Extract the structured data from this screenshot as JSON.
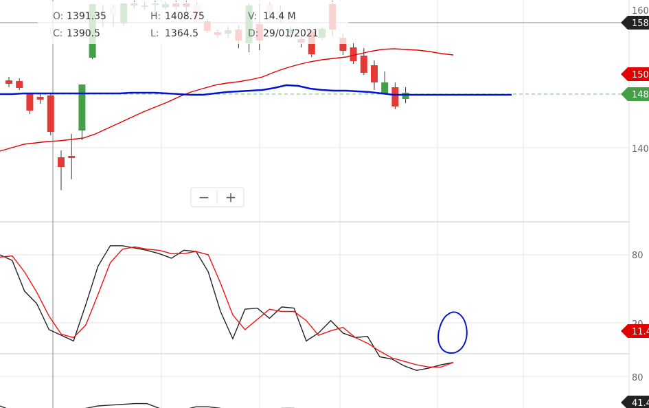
{
  "ohlc_info": {
    "open_label": "O:",
    "open_value": "1391.35",
    "high_label": "H:",
    "high_value": "1408.75",
    "volume_label": "V:",
    "volume_value": "14.4 M",
    "close_label": "C:",
    "close_value": "1390.5",
    "low_label": "L:",
    "low_value": "1364.5",
    "date_label": "D:",
    "date_value": "29/01/2021"
  },
  "zoom": {
    "minus": "−",
    "plus": "+"
  },
  "price_axis": {
    "tick_top": "160",
    "tick_mid": "140",
    "badge_top": "158",
    "badge_ma_red": "150",
    "badge_ma_blue": "148"
  },
  "osc_axis": {
    "tick_80": "80",
    "tick_20": "20",
    "badge": "11.4"
  },
  "ind3_axis": {
    "tick_80": "80",
    "badge": "41.4"
  },
  "colors": {
    "up": "#43a047",
    "up_light": "#c8e6c9",
    "down": "#e53935",
    "down_light": "#ffcdd2",
    "ma_red": "#e00000",
    "ma_blue": "#0014d0",
    "osc_k": "#222222",
    "osc_d": "#ee1111",
    "annotation": "#0016c8",
    "grid": "#e6e6e6",
    "axis_badge": "#222222"
  },
  "chart_data": [
    {
      "type": "candlestick",
      "title": "",
      "y_ticks": [
        1400,
        1600
      ],
      "ylim": [
        1360,
        1610
      ],
      "candles": [
        {
          "o": 1498,
          "h": 1503,
          "l": 1488,
          "c": 1493,
          "fill": "down"
        },
        {
          "o": 1497,
          "h": 1501,
          "l": 1484,
          "c": 1487,
          "fill": "down"
        },
        {
          "o": 1478,
          "h": 1480,
          "l": 1449,
          "c": 1454,
          "fill": "down"
        },
        {
          "o": 1474,
          "h": 1478,
          "l": 1464,
          "c": 1470,
          "fill": "down"
        },
        {
          "o": 1476,
          "h": 1478,
          "l": 1418,
          "c": 1423,
          "fill": "down"
        },
        {
          "o": 1386,
          "h": 1396,
          "l": 1338,
          "c": 1372,
          "fill": "down"
        },
        {
          "o": 1388,
          "h": 1420,
          "l": 1354,
          "c": 1385,
          "fill": "down"
        },
        {
          "o": 1425,
          "h": 1492,
          "l": 1411,
          "c": 1492,
          "fill": "up"
        },
        {
          "o": 1531,
          "h": 1609,
          "l": 1529,
          "c": 1609,
          "fill": "up"
        },
        {
          "o": 1600,
          "h": 1608,
          "l": 1576,
          "c": 1592,
          "fill": "up_light"
        },
        {
          "o": 1593,
          "h": 1608,
          "l": 1576,
          "c": 1605,
          "fill": "up_light"
        },
        {
          "o": 1581,
          "h": 1610,
          "l": 1578,
          "c": 1610,
          "fill": "up"
        },
        {
          "o": 1610,
          "h": 1614,
          "l": 1603,
          "c": 1607,
          "fill": "down"
        },
        {
          "o": 1607,
          "h": 1613,
          "l": 1601,
          "c": 1605,
          "fill": "up"
        },
        {
          "o": 1608,
          "h": 1614,
          "l": 1592,
          "c": 1610,
          "fill": "up"
        },
        {
          "o": 1604,
          "h": 1613,
          "l": 1601,
          "c": 1609,
          "fill": "up"
        },
        {
          "o": 1610,
          "h": 1614,
          "l": 1600,
          "c": 1605,
          "fill": "down"
        },
        {
          "o": 1610,
          "h": 1614,
          "l": 1598,
          "c": 1605,
          "fill": "down"
        },
        {
          "o": 1608,
          "h": 1612,
          "l": 1582,
          "c": 1584,
          "fill": "down_light"
        },
        {
          "o": 1584,
          "h": 1588,
          "l": 1567,
          "c": 1570,
          "fill": "down"
        },
        {
          "o": 1568,
          "h": 1572,
          "l": 1560,
          "c": 1564,
          "fill": "down"
        },
        {
          "o": 1566,
          "h": 1576,
          "l": 1560,
          "c": 1571,
          "fill": "up"
        },
        {
          "o": 1572,
          "h": 1578,
          "l": 1545,
          "c": 1556,
          "fill": "down"
        },
        {
          "o": 1552,
          "h": 1610,
          "l": 1539,
          "c": 1607,
          "fill": "up"
        },
        {
          "o": 1580,
          "h": 1610,
          "l": 1542,
          "c": 1556,
          "fill": "down"
        },
        {
          "o": 1608,
          "h": 1612,
          "l": 1586,
          "c": 1599,
          "fill": "down_light"
        },
        {
          "o": 1600,
          "h": 1607,
          "l": 1582,
          "c": 1592,
          "fill": "up_light"
        },
        {
          "o": 1573,
          "h": 1576,
          "l": 1563,
          "c": 1567,
          "fill": "up"
        },
        {
          "o": 1558,
          "h": 1565,
          "l": 1546,
          "c": 1553,
          "fill": "down"
        },
        {
          "o": 1569,
          "h": 1572,
          "l": 1532,
          "c": 1536,
          "fill": "down"
        },
        {
          "o": 1560,
          "h": 1576,
          "l": 1557,
          "c": 1573,
          "fill": "up"
        },
        {
          "o": 1609,
          "h": 1614,
          "l": 1562,
          "c": 1572,
          "fill": "down"
        },
        {
          "o": 1560,
          "h": 1565,
          "l": 1535,
          "c": 1541,
          "fill": "down"
        },
        {
          "o": 1546,
          "h": 1552,
          "l": 1522,
          "c": 1526,
          "fill": "down"
        },
        {
          "o": 1534,
          "h": 1545,
          "l": 1506,
          "c": 1509,
          "fill": "down"
        },
        {
          "o": 1520,
          "h": 1527,
          "l": 1484,
          "c": 1495,
          "fill": "down"
        },
        {
          "o": 1495,
          "h": 1511,
          "l": 1479,
          "c": 1479,
          "fill": "up"
        },
        {
          "o": 1488,
          "h": 1495,
          "l": 1456,
          "c": 1460,
          "fill": "down"
        },
        {
          "o": 1471,
          "h": 1488,
          "l": 1465,
          "c": 1480,
          "fill": "up"
        }
      ],
      "series": [
        {
          "color_key": "ma_red",
          "values": [
            1395,
            1400,
            1405,
            1407,
            1409,
            1410,
            1412,
            1414,
            1420,
            1428,
            1436,
            1444,
            1452,
            1459,
            1466,
            1474,
            1481,
            1486,
            1491,
            1494,
            1496,
            1499,
            1503,
            1510,
            1516,
            1521,
            1525,
            1528,
            1530,
            1532,
            1536,
            1540,
            1543,
            1544,
            1543,
            1542,
            1540,
            1537,
            1535
          ]
        },
        {
          "color_key": "ma_blue",
          "values": [
            1478,
            1478,
            1479,
            1479,
            1479,
            1479,
            1479,
            1479,
            1479,
            1479,
            1479,
            1480,
            1480,
            1480,
            1479,
            1478,
            1477,
            1477,
            1479,
            1481,
            1482,
            1483,
            1484,
            1487,
            1491,
            1490,
            1486,
            1484,
            1483,
            1483,
            1482,
            1481,
            1479,
            1477,
            1477,
            1477,
            1477,
            1477,
            1477
          ]
        }
      ]
    },
    {
      "type": "line",
      "title": "",
      "y_ticks": [
        20,
        80
      ],
      "ylim": [
        0,
        100
      ],
      "series": [
        {
          "color_key": "osc_k",
          "values": [
            80,
            75,
            48,
            37,
            14,
            9,
            4,
            36,
            70,
            88,
            88,
            86,
            84,
            81,
            77,
            84,
            83,
            65,
            30,
            6,
            32,
            33,
            24,
            34,
            33,
            4,
            11,
            22,
            11,
            7,
            8,
            -10,
            -12,
            -18,
            -22,
            -20,
            -17,
            -15
          ]
        },
        {
          "color_key": "osc_d",
          "values": [
            78,
            79,
            65,
            47,
            26,
            10,
            7,
            18,
            45,
            73,
            85,
            87,
            85,
            84,
            81,
            81,
            83,
            80,
            55,
            27,
            14,
            23,
            32,
            30,
            30,
            22,
            9,
            13,
            16,
            7,
            2,
            -5,
            -11,
            -14,
            -17,
            -19,
            -19,
            -15
          ]
        }
      ]
    },
    {
      "type": "line",
      "title": "",
      "y_ticks": [
        80
      ],
      "ylim": [
        0,
        100
      ],
      "series": [
        {
          "color_key": "osc_k",
          "values": [
            40,
            28,
            18,
            24,
            10,
            2,
            10,
            34,
            40,
            42,
            44,
            46,
            46,
            34,
            30,
            30,
            38,
            38,
            34,
            28,
            24,
            24,
            20,
            34,
            34,
            20,
            24,
            26,
            24,
            14,
            12,
            14,
            10,
            8,
            4,
            2,
            2,
            6
          ]
        }
      ]
    }
  ]
}
